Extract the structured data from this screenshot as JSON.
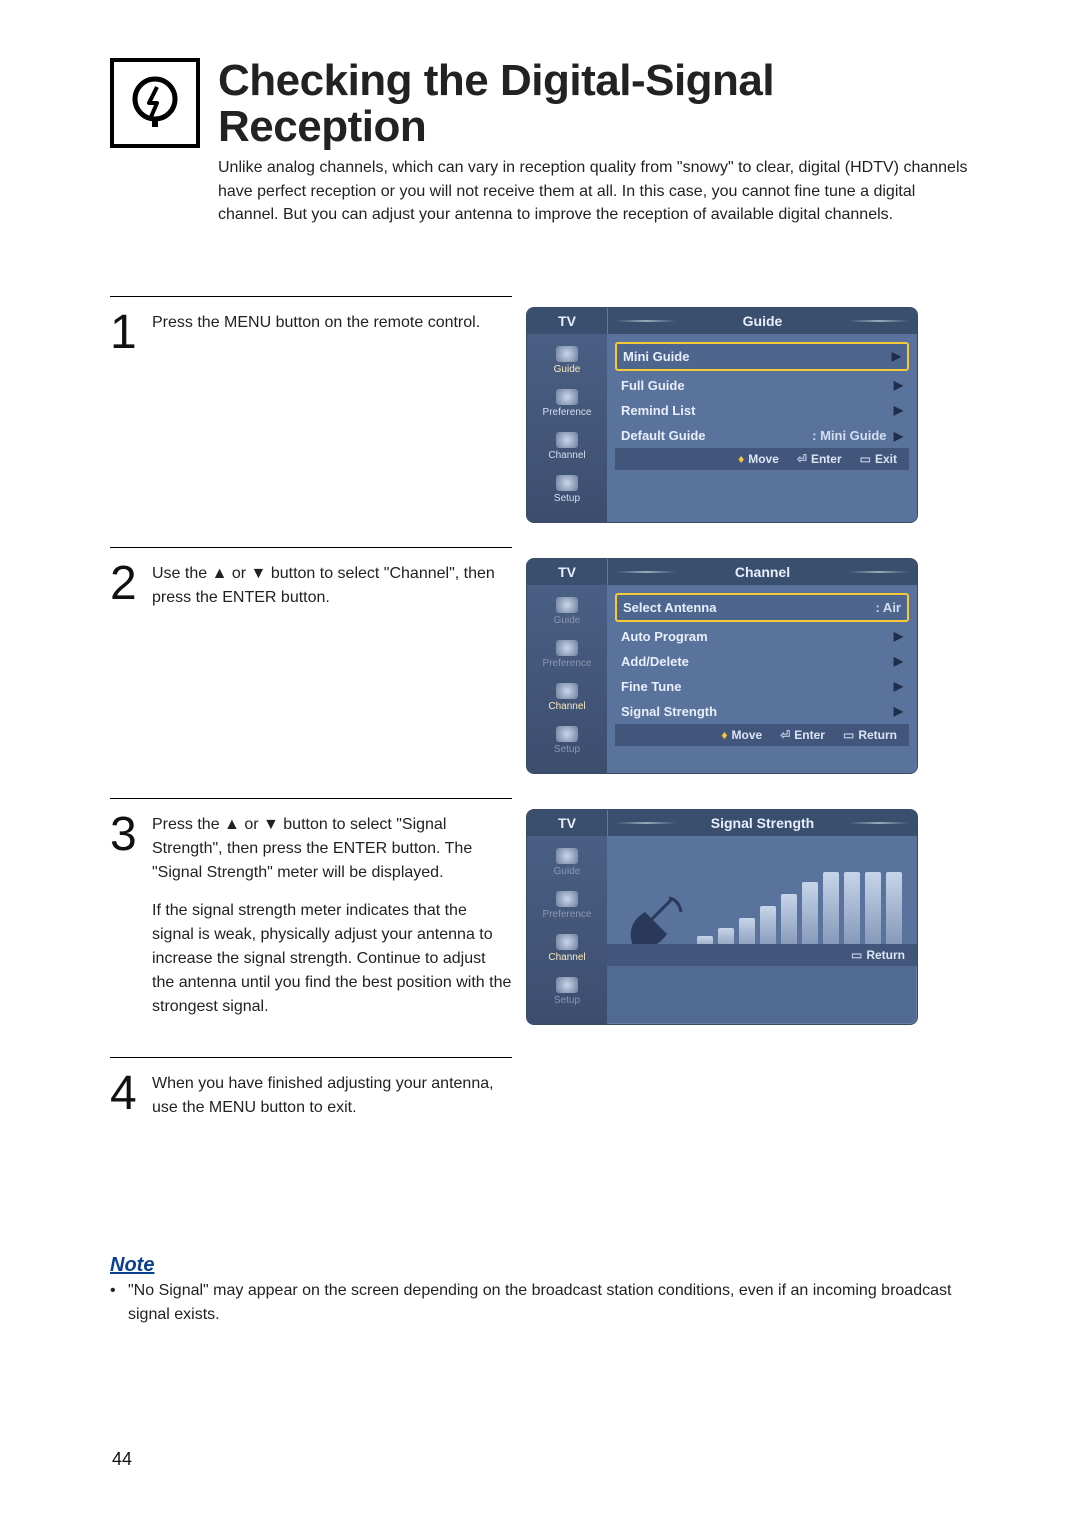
{
  "page_number": "44",
  "header": {
    "title": "Checking the Digital-Signal Reception",
    "subtitle": "Unlike analog channels, which can vary in reception quality from \"snowy\" to clear, digital (HDTV) channels have perfect reception or you will not receive them at all. In this case, you cannot fine tune a digital channel. But you can adjust your antenna to improve the reception of available digital channels."
  },
  "steps": {
    "s1": {
      "num": "1",
      "text": "Press the MENU button on the remote control."
    },
    "s2": {
      "num": "2",
      "text": "Use the ▲ or ▼ button to select \"Channel\", then press the ENTER button."
    },
    "s3": {
      "num": "3",
      "text_a": "Press the ▲ or ▼ button to select \"Signal Strength\", then press the ENTER button. The \"Signal Strength\" meter will be displayed.",
      "text_b": "If the signal strength meter indicates that the signal is weak, physically adjust your antenna to increase the signal strength. Continue to adjust the antenna until you find the best position with the strongest signal."
    },
    "s4": {
      "num": "4",
      "text": "When you have finished adjusting your antenna, use the MENU button to exit."
    }
  },
  "osd": {
    "tv_label": "TV",
    "side": {
      "guide": "Guide",
      "preference": "Preference",
      "channel": "Channel",
      "setup": "Setup"
    },
    "guide_menu": {
      "title": "Guide",
      "mini": "Mini Guide",
      "full": "Full Guide",
      "remind": "Remind List",
      "default_label": "Default Guide",
      "default_value": ": Mini Guide",
      "footer": {
        "move": "Move",
        "enter": "Enter",
        "exit": "Exit"
      }
    },
    "channel_menu": {
      "title": "Channel",
      "sel_ant_label": "Select Antenna",
      "sel_ant_value": ": Air",
      "auto": "Auto Program",
      "adddel": "Add/Delete",
      "fine": "Fine Tune",
      "sig": "Signal Strength",
      "footer": {
        "move": "Move",
        "enter": "Enter",
        "return": "Return"
      }
    },
    "signal_menu": {
      "title": "Signal Strength",
      "footer": {
        "return": "Return"
      }
    },
    "chevron": "▶"
  },
  "note": {
    "title": "Note",
    "body": "\"No Signal\" may appear on the screen depending on the broadcast station conditions, even if an incoming broadcast signal exists."
  }
}
